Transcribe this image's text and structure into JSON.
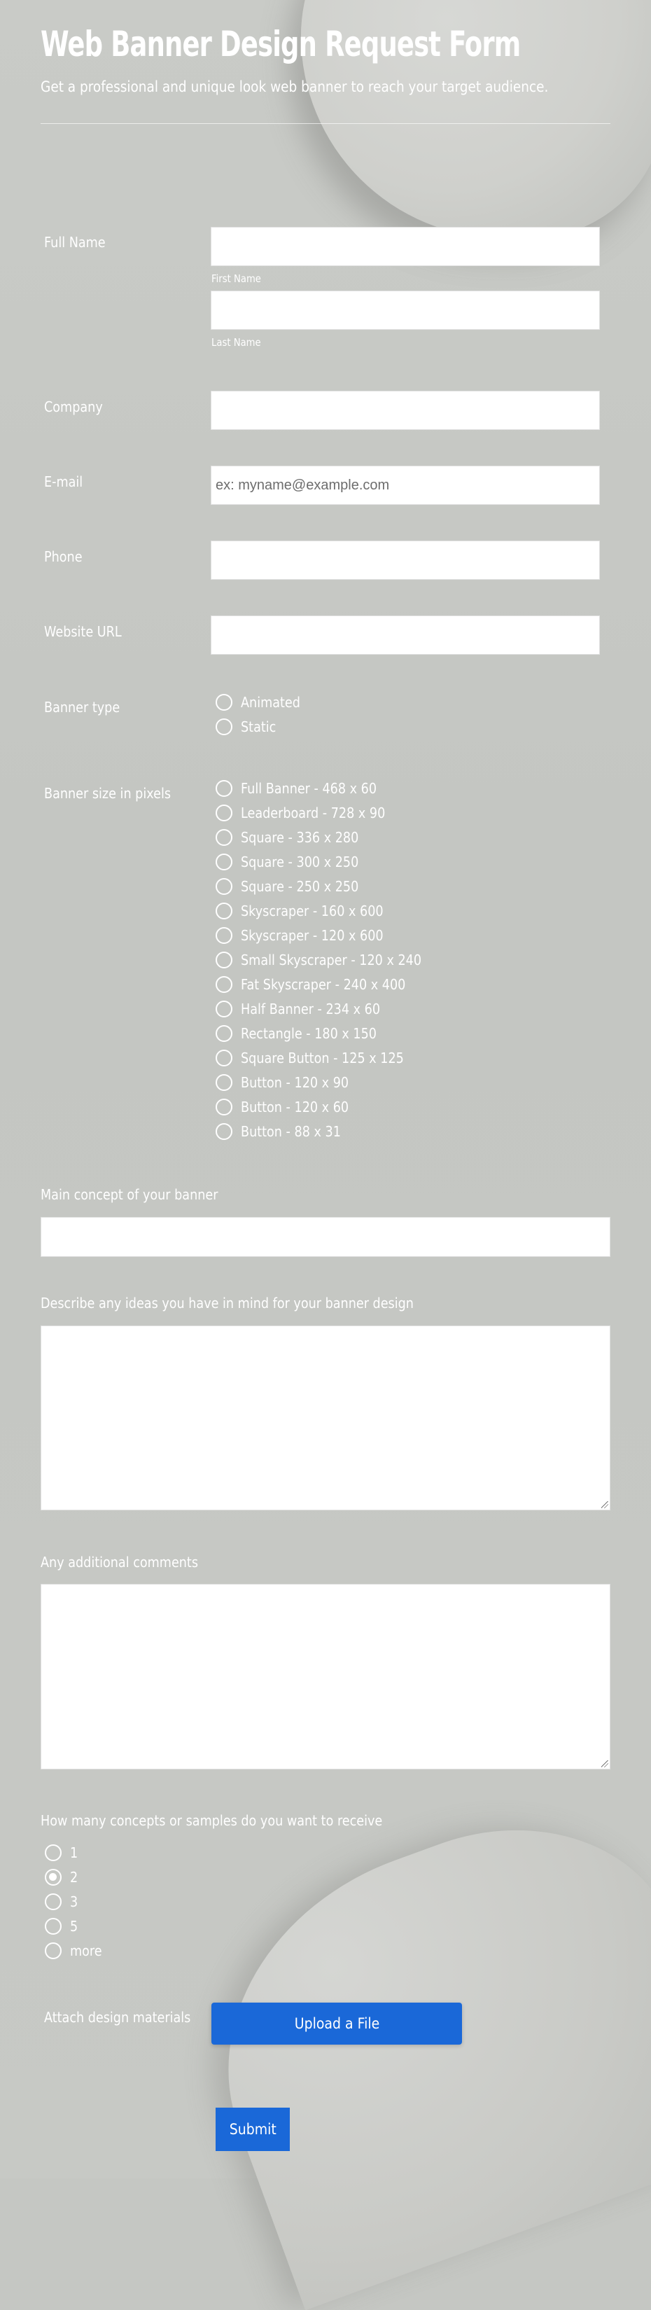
{
  "form": {
    "title": "Web Banner Design Request Form",
    "subtitle": "Get a professional and unique look web banner to reach your target audience."
  },
  "fields": {
    "full_name": {
      "label": "Full Name",
      "first_sublabel": "First Name",
      "last_sublabel": "Last Name",
      "first_value": "",
      "last_value": ""
    },
    "company": {
      "label": "Company",
      "value": ""
    },
    "email": {
      "label": "E-mail",
      "placeholder": "ex: myname@example.com",
      "value": ""
    },
    "phone": {
      "label": "Phone",
      "value": ""
    },
    "website": {
      "label": "Website URL",
      "value": ""
    },
    "banner_type": {
      "label": "Banner type",
      "options": [
        "Animated",
        "Static"
      ],
      "selected": null
    },
    "banner_size": {
      "label": "Banner size in pixels",
      "options": [
        "Full Banner - 468 x 60",
        "Leaderboard - 728 x 90",
        "Square - 336 x 280",
        "Square - 300 x 250",
        "Square - 250 x 250",
        "Skyscraper - 160 x 600",
        "Skyscraper - 120 x 600",
        "Small Skyscraper - 120 x 240",
        "Fat Skyscraper - 240 x 400",
        "Half Banner - 234 x 60",
        "Rectangle - 180 x 150",
        "Square Button - 125 x 125",
        "Button - 120 x 90",
        "Button - 120 x 60",
        "Button - 88 x 31"
      ],
      "selected": null
    },
    "main_concept": {
      "label": "Main concept of your banner",
      "value": ""
    },
    "ideas": {
      "label": "Describe any ideas you have in mind for your banner design",
      "value": ""
    },
    "comments": {
      "label": "Any additional comments",
      "value": ""
    },
    "concepts_count": {
      "label": "How many concepts or samples do you want to receive",
      "options": [
        "1",
        "2",
        "3",
        "5",
        "more"
      ],
      "selected": "2"
    },
    "attach": {
      "label": "Attach design materials",
      "button_label": "Upload a File"
    }
  },
  "submit_label": "Submit",
  "colors": {
    "background": "#c5c7c3",
    "text": "#ffffff",
    "button": "#1a68d8",
    "input_background": "#ffffff"
  }
}
